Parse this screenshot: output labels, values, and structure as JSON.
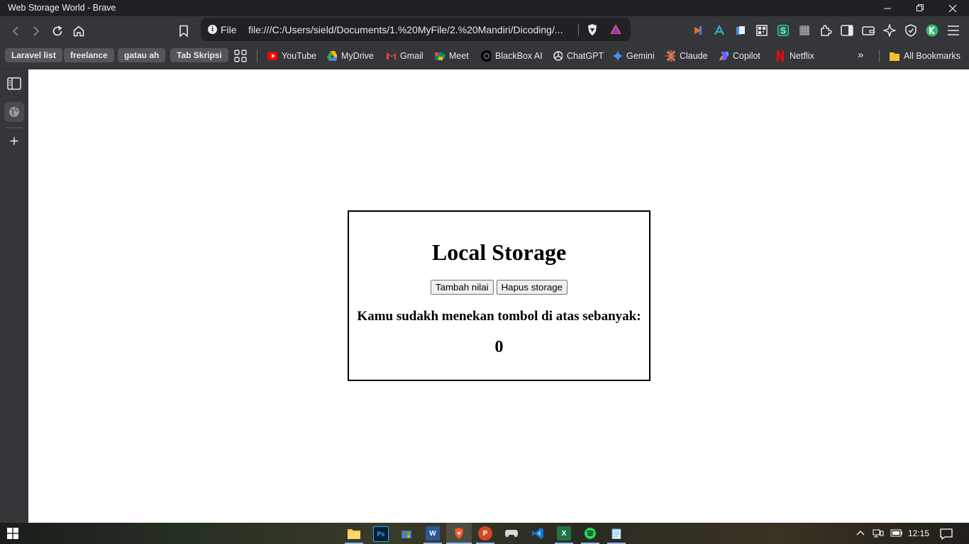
{
  "window": {
    "title": "Web Storage World - Brave"
  },
  "toolbar": {
    "scheme": "File",
    "url": "file:///C:/Users/sield/Documents/1.%20MyFile/2.%20Mandiri/Dicoding/..."
  },
  "bookmarks": {
    "folders": [
      "Laravel list",
      "freelance",
      "gatau ah",
      "Tab Skripsi"
    ],
    "links": [
      {
        "label": "YouTube",
        "icon": "youtube-icon",
        "color": "#ff0000"
      },
      {
        "label": "MyDrive",
        "icon": "drive-icon",
        "color": "#34a853"
      },
      {
        "label": "Gmail",
        "icon": "gmail-icon",
        "color": "#ea4335"
      },
      {
        "label": "Meet",
        "icon": "meet-icon",
        "color": "#00897b"
      },
      {
        "label": "BlackBox AI",
        "icon": "blackbox-icon",
        "color": "#000000"
      },
      {
        "label": "ChatGPT",
        "icon": "chatgpt-icon",
        "color": "#e8e8e8"
      },
      {
        "label": "Gemini",
        "icon": "gemini-icon",
        "color": "#4f8df5"
      },
      {
        "label": "Claude",
        "icon": "claude-icon",
        "color": "#d97757"
      },
      {
        "label": "Copilot",
        "icon": "copilot-icon",
        "color": "#7b5cff"
      },
      {
        "label": "Netflix",
        "icon": "netflix-icon",
        "color": "#e50914"
      }
    ],
    "all_bookmarks": "All Bookmarks"
  },
  "page": {
    "heading": "Local Storage",
    "add_button": "Tambah nilai",
    "clear_button": "Hapus storage",
    "message": "Kamu sudakh menekan tombol di atas sebanyak:",
    "count": "0"
  },
  "taskbar": {
    "time": "12:15"
  }
}
